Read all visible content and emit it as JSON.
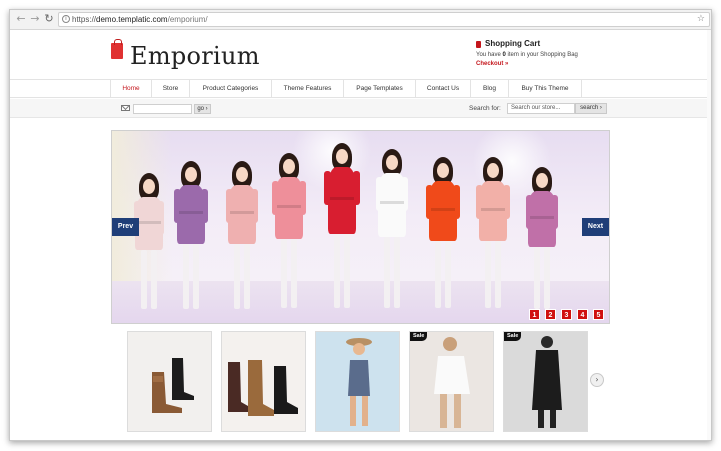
{
  "browser": {
    "back_icon": "arrow-left-icon",
    "forward_icon": "arrow-right-icon",
    "reload_icon": "reload-icon",
    "url_scheme": "https://",
    "url_host": "demo.templatic.com",
    "url_path": "/emporium/",
    "info_glyph": "i",
    "star_glyph": "☆"
  },
  "header": {
    "logo": "Emporium",
    "cart_title": "Shopping Cart",
    "cart_text_prefix": "You have",
    "cart_count": "0",
    "cart_text_suffix": "item in your Shopping Bag",
    "checkout": "Checkout »"
  },
  "menu": {
    "items": [
      {
        "label": "Home",
        "active": true
      },
      {
        "label": "Store"
      },
      {
        "label": "Product Categories"
      },
      {
        "label": "Theme Features"
      },
      {
        "label": "Page Templates"
      },
      {
        "label": "Contact Us"
      },
      {
        "label": "Blog"
      },
      {
        "label": "Buy This Theme"
      }
    ]
  },
  "subbar": {
    "go": "go ›",
    "search_label": "Search for:",
    "search_placeholder": "Search our store...",
    "search_button": "search ›"
  },
  "slider": {
    "prev": "Prev",
    "next": "Next",
    "pages": [
      "1",
      "2",
      "3",
      "4",
      "5"
    ]
  },
  "thumbnails": [
    {
      "subject": "boots",
      "sale": false
    },
    {
      "subject": "boots",
      "sale": false
    },
    {
      "subject": "model",
      "sale": false
    },
    {
      "subject": "model",
      "sale": true
    },
    {
      "subject": "model",
      "sale": true
    }
  ],
  "sale_label": "Sale",
  "carousel_next_glyph": "›",
  "colors": {
    "accent_red": "#c4161c",
    "slider_nav_blue": "#1f3e78",
    "pager_red": "#d01010"
  }
}
